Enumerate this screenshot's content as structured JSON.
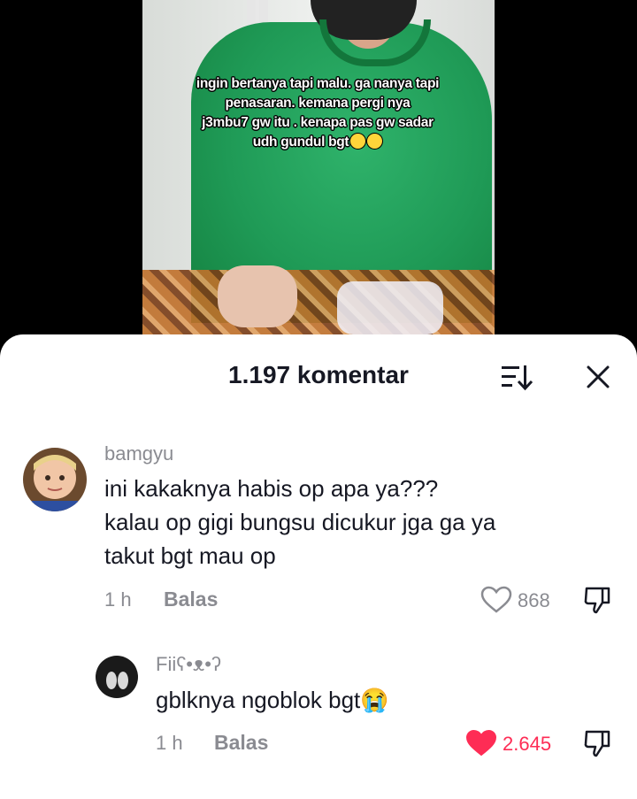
{
  "video": {
    "caption_lines": [
      "ingin bertanya tapi malu. ga nanya tapi",
      "penasaran. kemana pergi nya",
      "j3mbu7 gw itu . kenapa pas gw sadar",
      "udh gundul bgt"
    ]
  },
  "comments_sheet": {
    "title": "1.197 komentar",
    "sort_icon": "sort-icon",
    "close_icon": "close-icon"
  },
  "comments": [
    {
      "username": "bamgyu",
      "lines": [
        "ini kakaknya habis op apa ya???",
        "kalau op gigi bungsu dicukur jga ga ya",
        "takut bgt mau op"
      ],
      "time": "1 h",
      "reply_label": "Balas",
      "likes": "868",
      "liked": false
    },
    {
      "username": "Fiiʕ•ᴥ•ʔ",
      "lines": [
        "gblknya ngoblok bgt😭"
      ],
      "time": "1 h",
      "reply_label": "Balas",
      "likes": "2.645",
      "liked": true
    }
  ],
  "colors": {
    "like_active": "#fe2c55",
    "muted": "#8a8b91",
    "text": "#161823"
  }
}
